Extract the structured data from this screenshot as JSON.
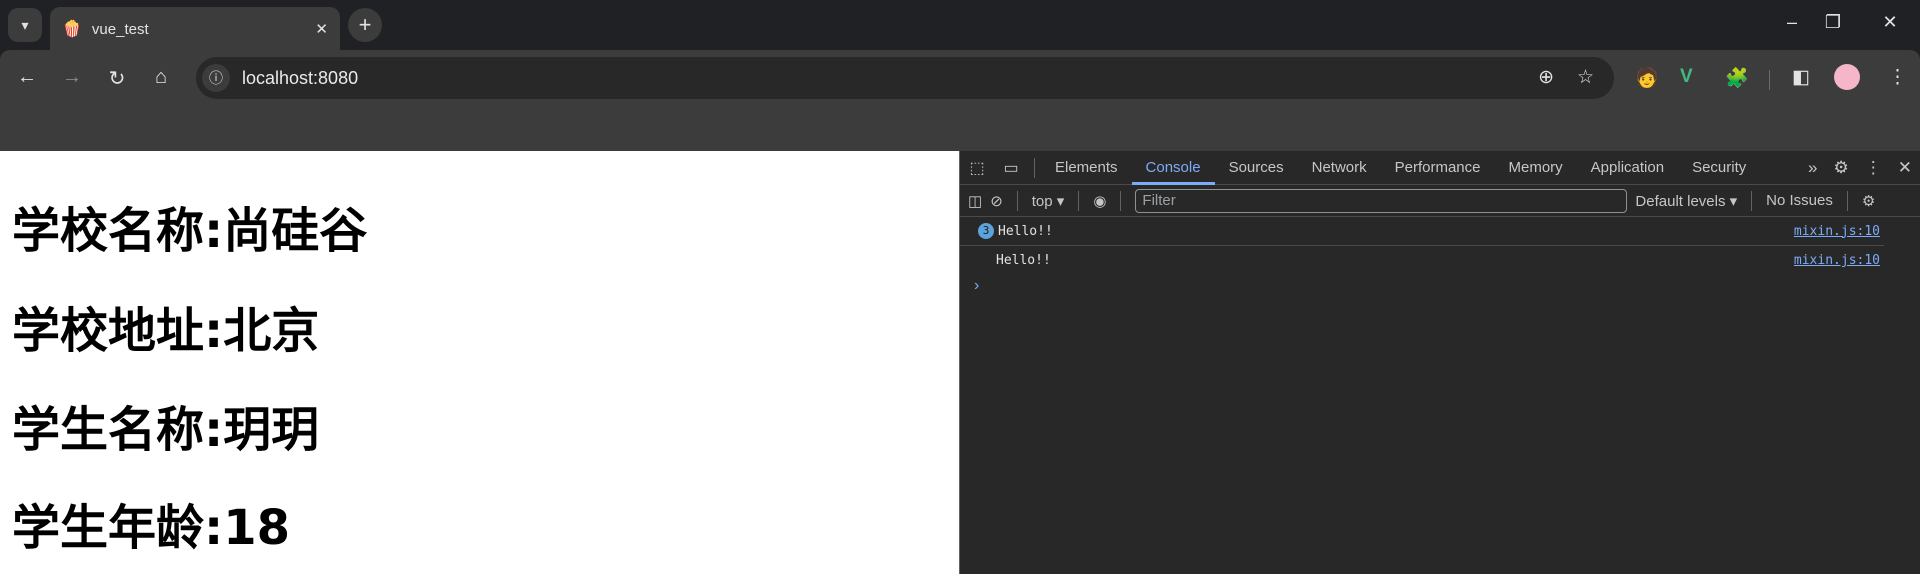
{
  "browser": {
    "tab": {
      "title": "vue_test",
      "favicon": "popcorn-icon",
      "close": "✕"
    },
    "new_tab": "+",
    "address": "localhost:8080",
    "accent": "#7cacf8"
  },
  "page": {
    "lines": [
      "学校名称:尚硅谷",
      "学校地址:北京",
      "学生名称:玥玥",
      "学生年龄:18"
    ]
  },
  "devtools": {
    "tabs": [
      "Elements",
      "Console",
      "Sources",
      "Network",
      "Performance",
      "Memory",
      "Application",
      "Security"
    ],
    "active_tab": "Console",
    "context": "top",
    "filter_placeholder": "Filter",
    "levels": "Default levels",
    "issues": "No Issues",
    "messages": [
      {
        "count": "3",
        "text": "Hello!!",
        "source": "mixin.js:10"
      },
      {
        "count": "",
        "text": "Hello!!",
        "source": "mixin.js:10"
      }
    ],
    "prompt": "›"
  }
}
